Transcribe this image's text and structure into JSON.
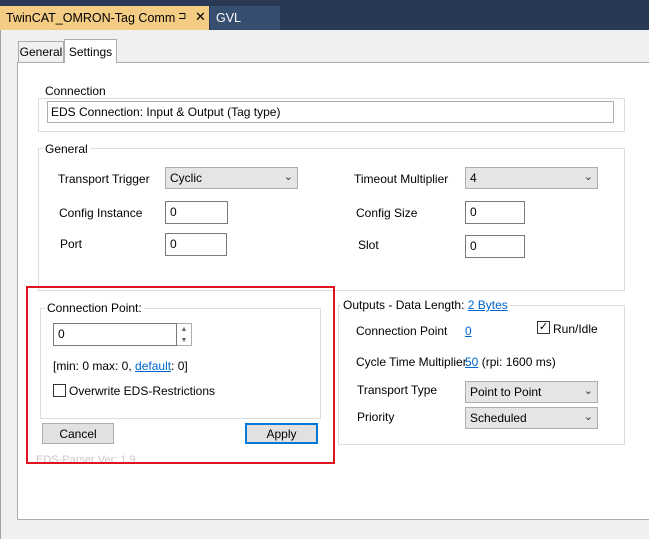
{
  "document_tabs": [
    {
      "label": "TwinCAT_OMRON-Tag Comm",
      "pin": "⊐",
      "close": "✕"
    },
    {
      "label": "GVL"
    }
  ],
  "property_tabs": {
    "general": "General",
    "settings": "Settings"
  },
  "connection": {
    "group_title": "Connection",
    "value": "EDS Connection: Input & Output (Tag type)"
  },
  "general": {
    "group_title": "General",
    "transport_trigger_label": "Transport Trigger",
    "transport_trigger_value": "Cyclic",
    "timeout_multiplier_label": "Timeout Multiplier",
    "timeout_multiplier_value": "4",
    "config_instance_label": "Config Instance",
    "config_instance_value": "0",
    "config_size_label": "Config Size",
    "config_size_value": "0",
    "port_label": "Port",
    "port_value": "0",
    "slot_label": "Slot",
    "slot_value": "0"
  },
  "connection_point": {
    "group_title": "Connection Point:",
    "value": "0",
    "range_prefix": "[min: 0 max: 0,",
    "default_link": "default",
    "range_suffix": ": 0]",
    "overwrite_label": "Overwrite EDS-Restrictions",
    "overwrite_checked": false
  },
  "buttons": {
    "cancel": "Cancel",
    "apply": "Apply"
  },
  "parser_version": "EDS-Parser Ver: 1.9",
  "outputs": {
    "group_title": "Outputs - Data Length:",
    "data_length_link": "2 Bytes",
    "connection_point_label": "Connection Point",
    "connection_point_link": "0",
    "run_idle_label": "Run/Idle",
    "run_idle_checked": true,
    "cycle_time_label": "Cycle Time Multiplier",
    "cycle_time_link": "50",
    "cycle_time_rpi": "(rpi: 1600 ms)",
    "transport_type_label": "Transport Type",
    "transport_type_value": "Point to Point",
    "priority_label": "Priority",
    "priority_value": "Scheduled"
  },
  "icons": {
    "chevron": "chevron-down-icon",
    "check": "✓",
    "spin_up": "▲",
    "spin_down": "▼"
  },
  "colors": {
    "tab_bar": "#293955",
    "active_tab": "#f5cc84",
    "highlight_box": "#e0141e",
    "link": "#0066cc"
  }
}
